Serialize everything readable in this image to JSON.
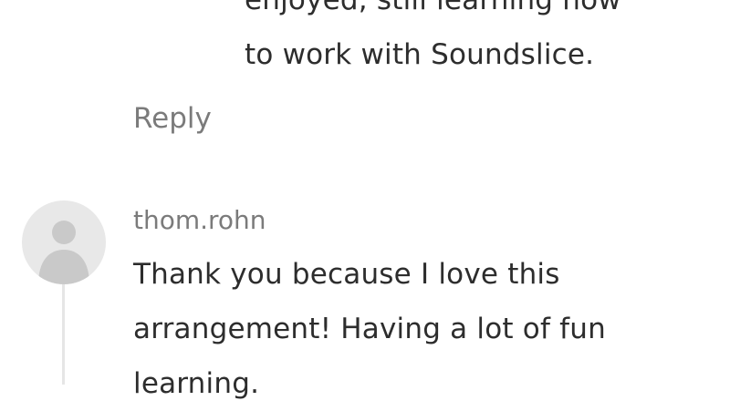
{
  "previous_reply": {
    "lines": [
      "enjoyed, still learning how",
      "to work with Soundslice."
    ],
    "reply_label": "Reply"
  },
  "comment": {
    "username": "thom.rohn",
    "avatar_icon": "default-user-avatar-icon",
    "lines": [
      "Thank you because I love this",
      "arrangement! Having a lot of fun",
      "learning."
    ]
  },
  "colors": {
    "text": "#2d2d2d",
    "muted": "#7b7b7b",
    "avatar_bg": "#e8e8e8",
    "avatar_fg": "#c9c9c9"
  }
}
